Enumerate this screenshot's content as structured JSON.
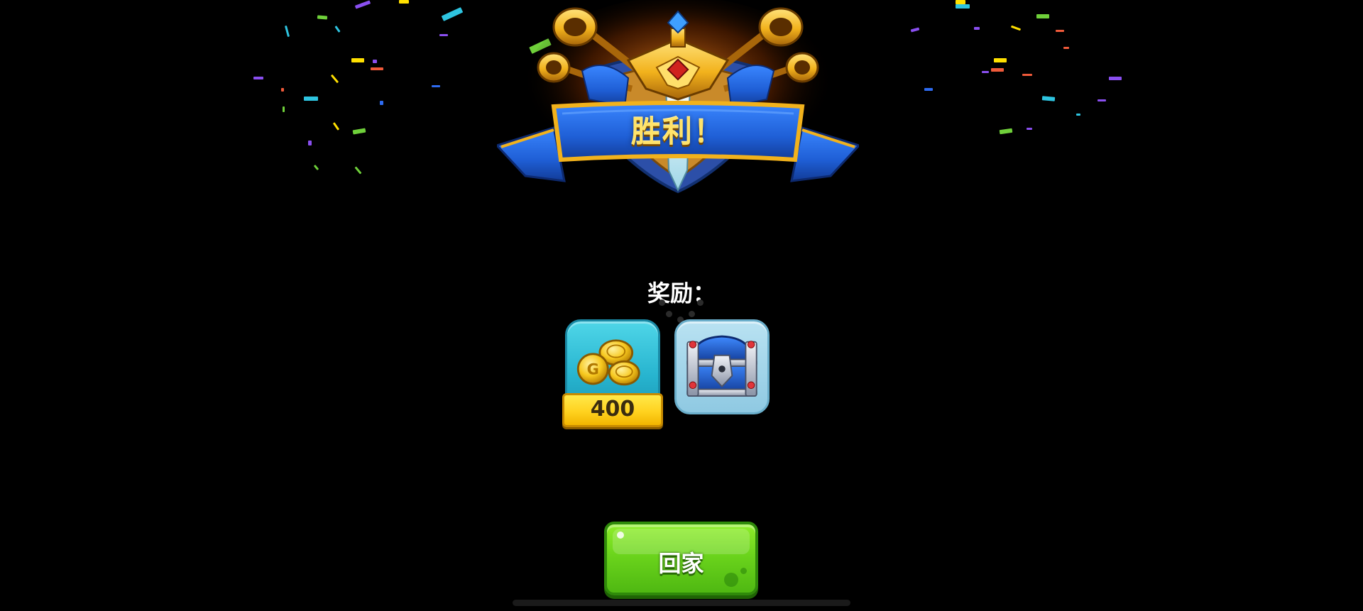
{
  "screen": {
    "name": "victory-screen",
    "background_color": "#000000"
  },
  "banner": {
    "title": "胜利！",
    "icon": "victory-emblem-icon"
  },
  "rewards": {
    "heading": "奖励：",
    "items": [
      {
        "type": "coins",
        "icon": "gold-coins-icon",
        "amount": "400"
      },
      {
        "type": "chest",
        "icon": "treasure-chest-icon"
      }
    ]
  },
  "actions": {
    "home_label": "回家"
  },
  "colors": {
    "banner_blue": "#1f5fd6",
    "banner_gold": "#f2b21c",
    "coin_card": "#27b4cf",
    "chest_card": "#8fc9e2",
    "amount_plate": "#ffd21f",
    "home_button": "#6bd41c"
  }
}
